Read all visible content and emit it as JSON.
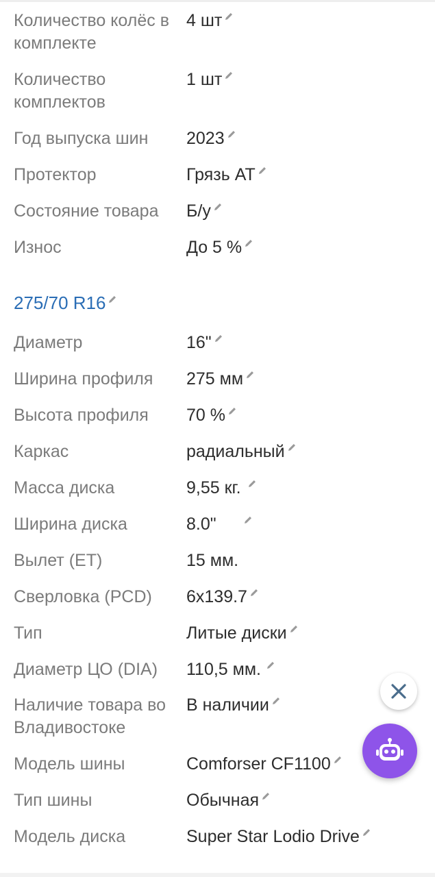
{
  "specs_top": [
    {
      "label": "Количество колёс в комплекте",
      "value": "4 шт",
      "editable": true
    },
    {
      "label": "Количество комплектов",
      "value": "1 шт",
      "editable": true
    },
    {
      "label": "Год выпуска шин",
      "value": "2023",
      "editable": true
    },
    {
      "label": "Протектор",
      "value": "Грязь AT",
      "editable": true
    },
    {
      "label": "Состояние товара",
      "value": "Б/у",
      "editable": true
    },
    {
      "label": "Износ",
      "value": "До 5 %",
      "editable": true
    }
  ],
  "section": {
    "title": "275/70 R16"
  },
  "specs_bottom": [
    {
      "label": "Диаметр",
      "value": "16\"",
      "editable": true
    },
    {
      "label": "Ширина профиля",
      "value": "275 мм",
      "editable": true
    },
    {
      "label": "Высота профиля",
      "value": "70 %",
      "editable": true
    },
    {
      "label": "Каркас",
      "value": "радиальный",
      "editable": true
    },
    {
      "label": "Масса диска",
      "value": "9,55 кг.",
      "editable": true
    },
    {
      "label": "Ширина диска",
      "value": "8.0\"",
      "editable": true
    },
    {
      "label": "Вылет (ET)",
      "value": "15 мм.",
      "editable": false
    },
    {
      "label": "Сверловка (PCD)",
      "value": "6x139.7",
      "editable": true
    },
    {
      "label": "Тип",
      "value": "Литые диски",
      "editable": true
    },
    {
      "label": "Диаметр ЦО (DIA)",
      "value": "110,5 мм.",
      "editable": true
    },
    {
      "label": "Наличие товара во Владивостоке",
      "value": "В наличии",
      "editable": true
    },
    {
      "label": "Модель шины",
      "value": "Comforser CF1100",
      "editable": true
    },
    {
      "label": "Тип шины",
      "value": "Обычная",
      "editable": true
    },
    {
      "label": "Модель диска",
      "value": "Super Star Lodio Drive",
      "editable": true
    }
  ],
  "icons": {
    "edit": "pencil-icon",
    "close": "close-icon",
    "assistant": "robot-icon"
  },
  "colors": {
    "label": "#7b7b7b",
    "value": "#2d2d2d",
    "section_title": "#2a6db5",
    "pencil": "#9a9a9a",
    "close_icon": "#4a6d8c",
    "assistant_bg": "#8e54e9"
  }
}
